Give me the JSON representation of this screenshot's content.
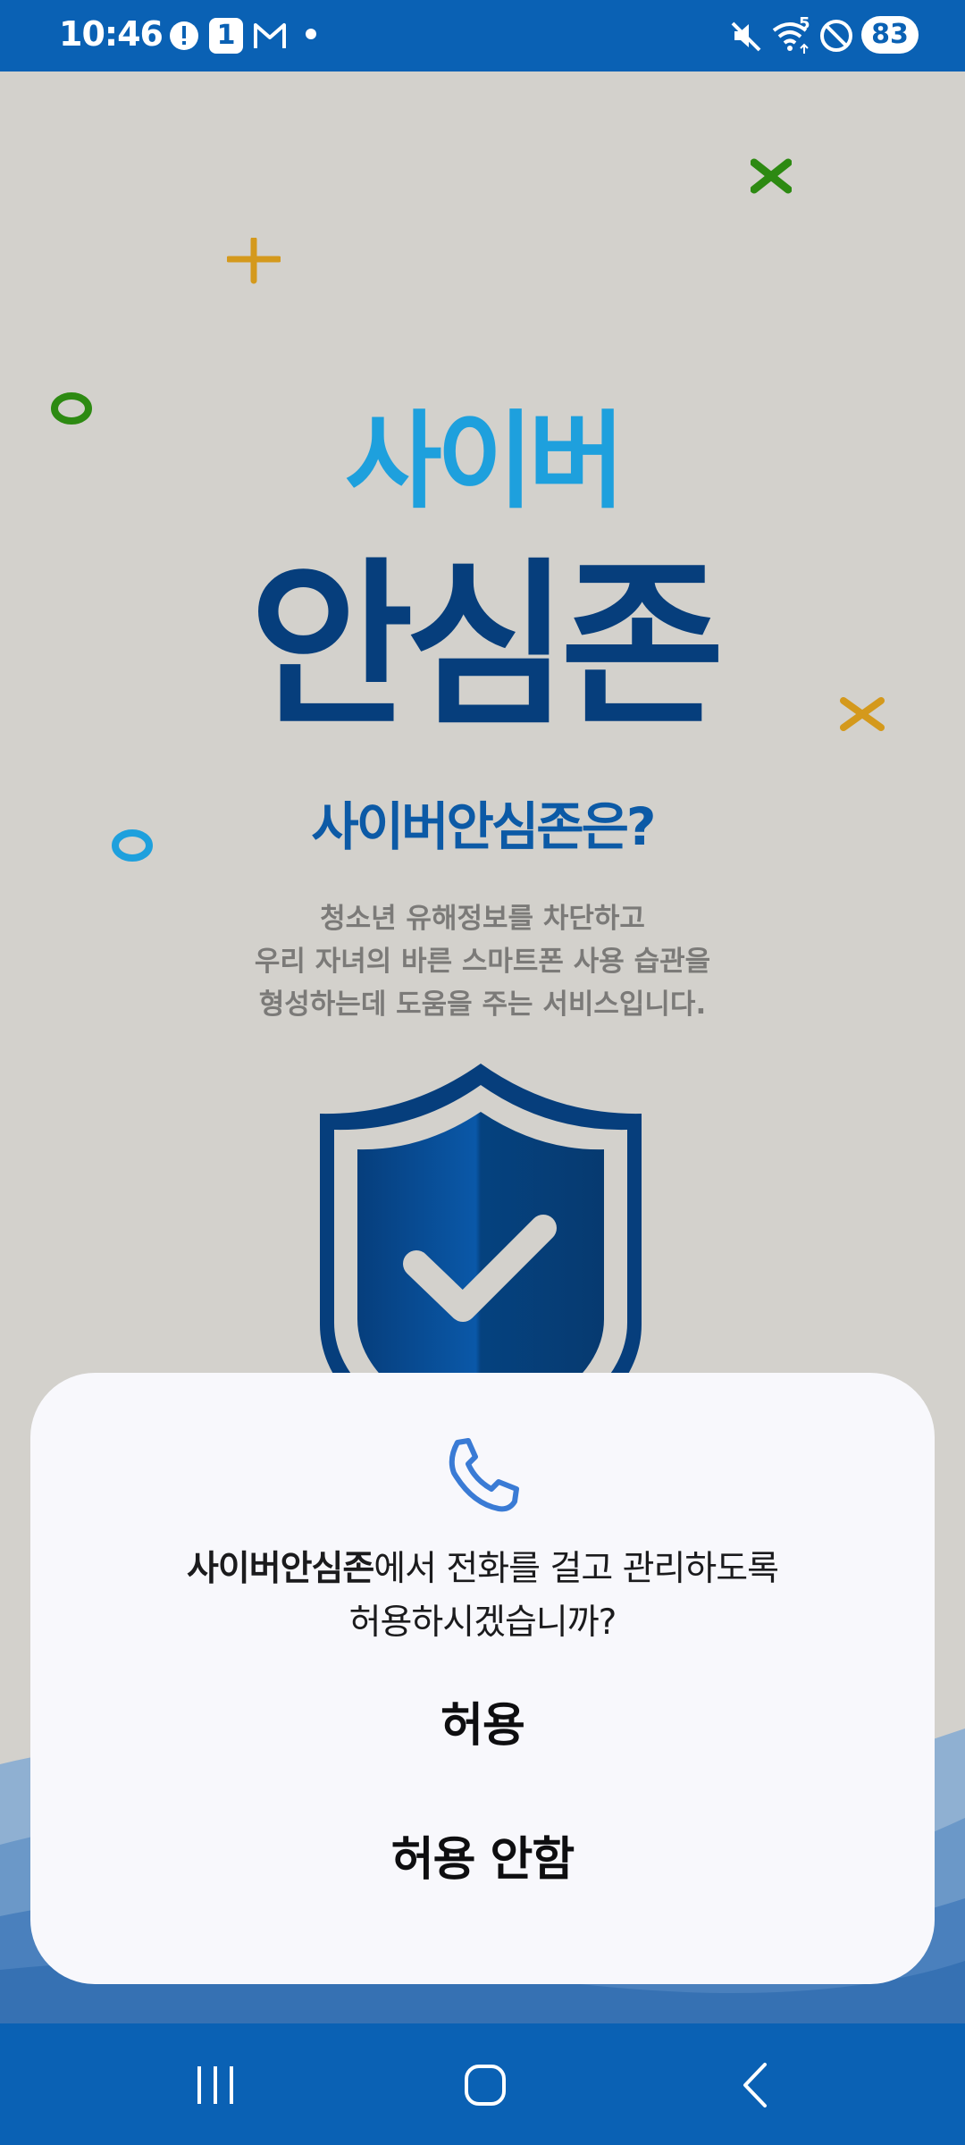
{
  "status_bar": {
    "time": "10:46",
    "notification_count": "1",
    "wifi_label": "5",
    "battery": "83"
  },
  "app": {
    "logo_top": "사이버",
    "logo_main": "안심존",
    "subheading": "사이버안심존은?",
    "description": [
      "청소년 유해정보를 차단하고",
      "우리 자녀의 바른 스마트폰 사용 습관을",
      "형성하는데 도움을 주는 서비스입니다."
    ]
  },
  "dialog": {
    "icon": "phone-icon",
    "app_name": "사이버안심존",
    "message_rest": "에서 전화를 걸고 관리하도록",
    "message_line2": "허용하시겠습니까?",
    "allow_label": "허용",
    "deny_label": "허용 안함"
  },
  "nav_bar": {
    "recents": "recents-icon",
    "home": "home-icon",
    "back": "back-icon"
  },
  "colors": {
    "status_bar": "#0a61b4",
    "background": "#d3d1cc",
    "logo_light": "#1ea0dd",
    "logo_dark": "#063e7c",
    "dialog_bg": "#f8f8fc",
    "phone_icon": "#3a7bd5"
  }
}
